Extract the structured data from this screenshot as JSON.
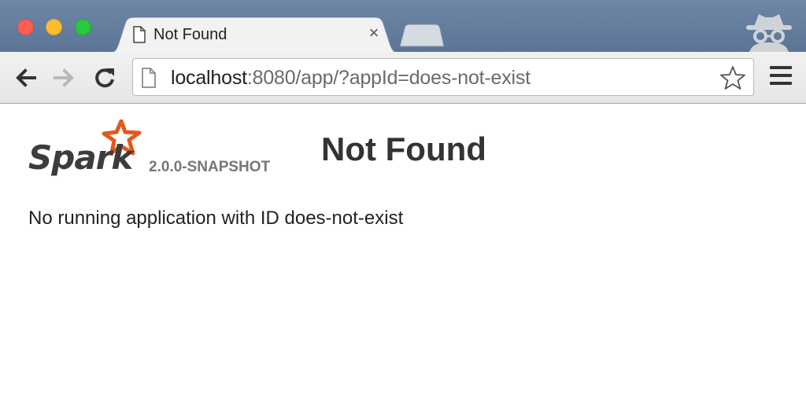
{
  "browser": {
    "tab": {
      "title": "Not Found",
      "close_label": "×",
      "icon": "page-icon"
    },
    "new_tab_icon": "new-tab-icon",
    "incognito_icon": "incognito-icon",
    "toolbar": {
      "back_icon": "back-arrow-icon",
      "forward_icon": "forward-arrow-icon",
      "reload_icon": "reload-icon",
      "url_host": "localhost",
      "url_rest": ":8080/app/?appId=does-not-exist",
      "bookmark_icon": "star-icon",
      "menu_icon": "hamburger-menu-icon"
    },
    "colors": {
      "tabstrip": "#5b7596",
      "close": "#fc5f57",
      "minimize": "#fdbc2e",
      "maximize": "#2ac940"
    }
  },
  "page": {
    "logo_text": "Spark",
    "logo_accent_color": "#e25a1c",
    "version": "2.0.0-SNAPSHOT",
    "heading": "Not Found",
    "message": "No running application with ID does-not-exist"
  }
}
